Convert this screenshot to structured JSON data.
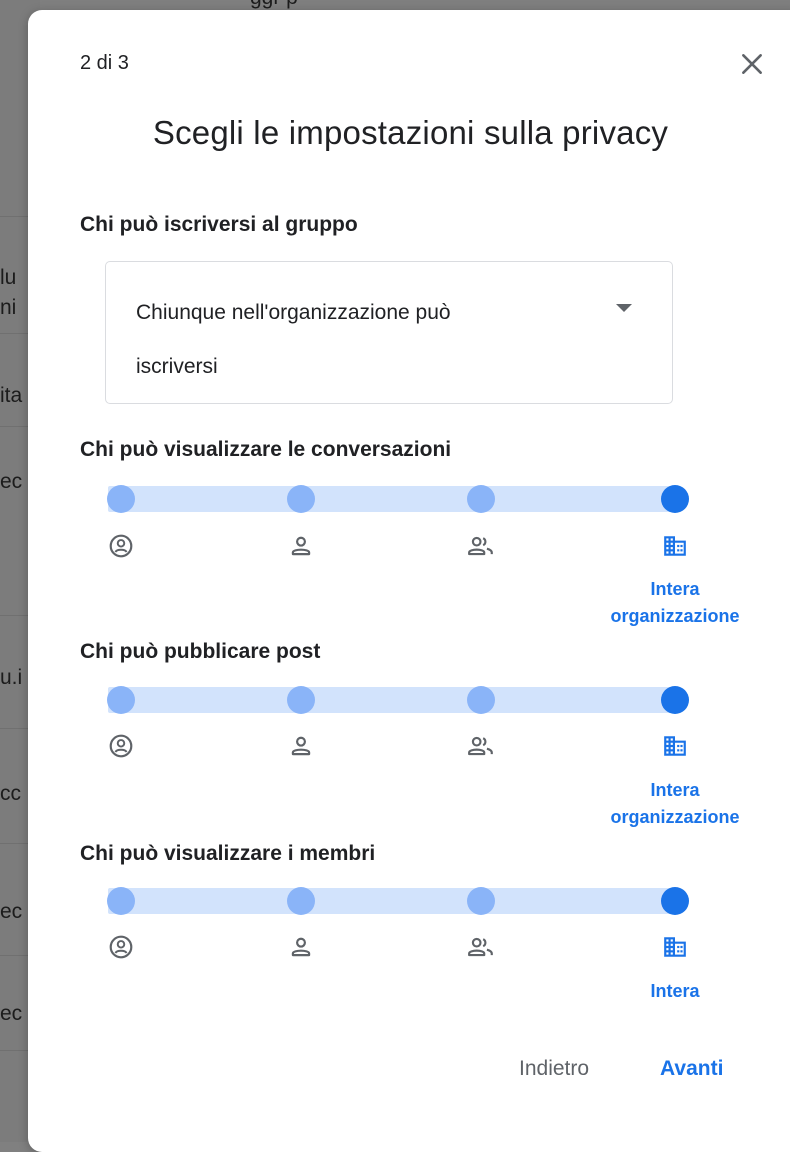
{
  "background": {
    "side_texts": [
      "lu",
      "ni",
      "ita",
      "ec",
      "u.i",
      "cc",
      "ec",
      "ec"
    ],
    "top_text": "ggr p"
  },
  "dialog": {
    "step": "2 di 3",
    "title": "Scegli le impostazioni sulla privacy",
    "close_icon": "close-icon",
    "join": {
      "heading": "Chi può iscriversi al gruppo",
      "value_line1": "Chiunque nell'organizzazione può",
      "value_line2": "iscriversi",
      "arrow_icon": "dropdown-arrow-icon"
    },
    "sliders": [
      {
        "heading": "Chi può visualizzare le conversazioni",
        "selected_index": 3,
        "levels": [
          "owner-icon",
          "person-icon",
          "group-icon",
          "domain-icon"
        ],
        "selected_label_line1": "Intera",
        "selected_label_line2": "organizzazione"
      },
      {
        "heading": "Chi può pubblicare post",
        "selected_index": 3,
        "levels": [
          "owner-icon",
          "person-icon",
          "group-icon",
          "domain-icon"
        ],
        "selected_label_line1": "Intera",
        "selected_label_line2": "organizzazione"
      },
      {
        "heading": "Chi può visualizzare i membri",
        "selected_index": 3,
        "levels": [
          "owner-icon",
          "person-icon",
          "group-icon",
          "domain-icon"
        ],
        "selected_label_line1": "Intera",
        "selected_label_line2": ""
      }
    ],
    "buttons": {
      "back": "Indietro",
      "next": "Avanti"
    }
  },
  "colors": {
    "accent": "#1a73e8",
    "track": "#d2e3fc",
    "stop": "#8ab4f8",
    "icon_gray": "#5f6368"
  }
}
